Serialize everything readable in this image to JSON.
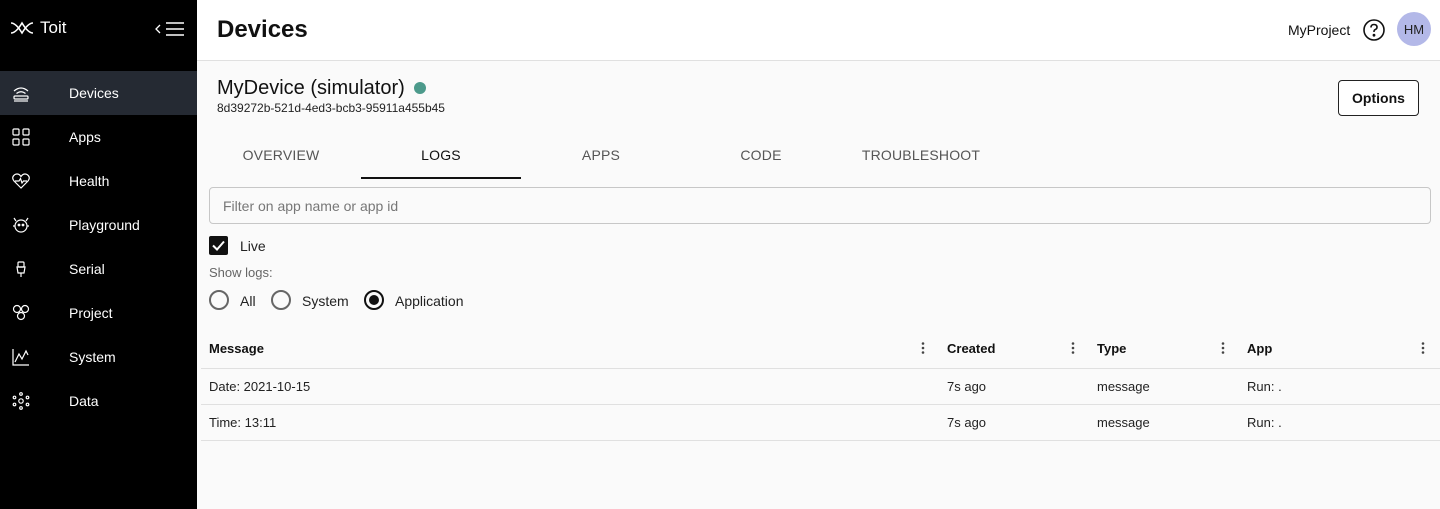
{
  "app": {
    "brand": "Toit",
    "colors": {
      "accent": "#4c9a8b",
      "sidebar_bg": "#000000",
      "avatar_bg": "#b3b8e8"
    }
  },
  "sidebar": {
    "items": [
      {
        "label": "Devices",
        "icon": "devices-icon",
        "active": true
      },
      {
        "label": "Apps",
        "icon": "apps-icon"
      },
      {
        "label": "Health",
        "icon": "health-icon"
      },
      {
        "label": "Playground",
        "icon": "playground-icon"
      },
      {
        "label": "Serial",
        "icon": "serial-icon"
      },
      {
        "label": "Project",
        "icon": "project-icon"
      },
      {
        "label": "System",
        "icon": "system-icon"
      },
      {
        "label": "Data",
        "icon": "data-icon"
      }
    ]
  },
  "header": {
    "title": "Devices",
    "project": "MyProject",
    "avatar": "HM"
  },
  "device": {
    "name": "MyDevice (simulator)",
    "id": "8d39272b-521d-4ed3-bcb3-95911a455b45",
    "options_label": "Options"
  },
  "tabs": [
    {
      "label": "OVERVIEW"
    },
    {
      "label": "LOGS",
      "active": true
    },
    {
      "label": "APPS"
    },
    {
      "label": "CODE"
    },
    {
      "label": "TROUBLESHOOT"
    }
  ],
  "logs": {
    "filter_placeholder": "Filter on app name or app id",
    "live_label": "Live",
    "live_checked": true,
    "show_logs_label": "Show logs:",
    "options": [
      {
        "label": "All"
      },
      {
        "label": "System"
      },
      {
        "label": "Application",
        "selected": true
      }
    ]
  },
  "table": {
    "columns": [
      "Message",
      "Created",
      "Type",
      "App"
    ],
    "rows": [
      [
        "Date: 2021-10-15",
        "7s ago",
        "message",
        "Run: ."
      ],
      [
        "Time: 13:11",
        "7s ago",
        "message",
        "Run: ."
      ]
    ]
  }
}
